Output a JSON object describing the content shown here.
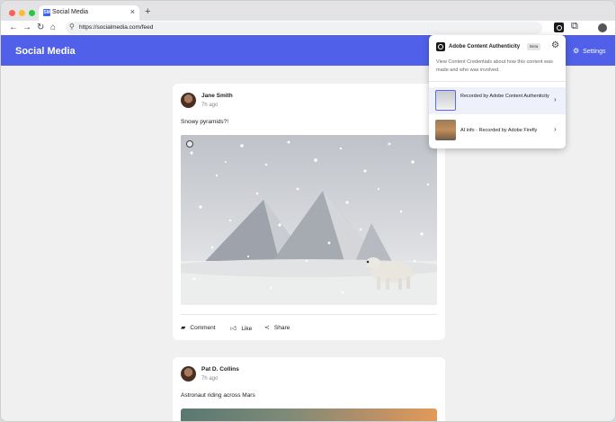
{
  "browser": {
    "tab_title": "Social Media",
    "tab_favicon_text": "SM",
    "url": "https://socialmedia.com/feed"
  },
  "site": {
    "title": "Social Media",
    "settings_label": "Settings"
  },
  "posts": [
    {
      "author": "Jane Smith",
      "time": "7h ago",
      "caption": "Snowy pyramids?!",
      "actions": [
        "Comment",
        "Like",
        "Share"
      ]
    },
    {
      "author": "Pat D. Collins",
      "time": "7h ago",
      "caption": "Astronaut riding across Mars"
    }
  ],
  "popup": {
    "title": "Adobe Content Authenticity",
    "badge": "Beta",
    "description": "View Content Credentials about how this content was made and who was involved.",
    "credentials": [
      {
        "label": "Recorded by Adobe Content Authenticity"
      },
      {
        "label": "AI info · Recorded by Adobe Firefly"
      }
    ]
  },
  "colors": {
    "brand": "#5060e8",
    "selection": "#eef0fb"
  }
}
